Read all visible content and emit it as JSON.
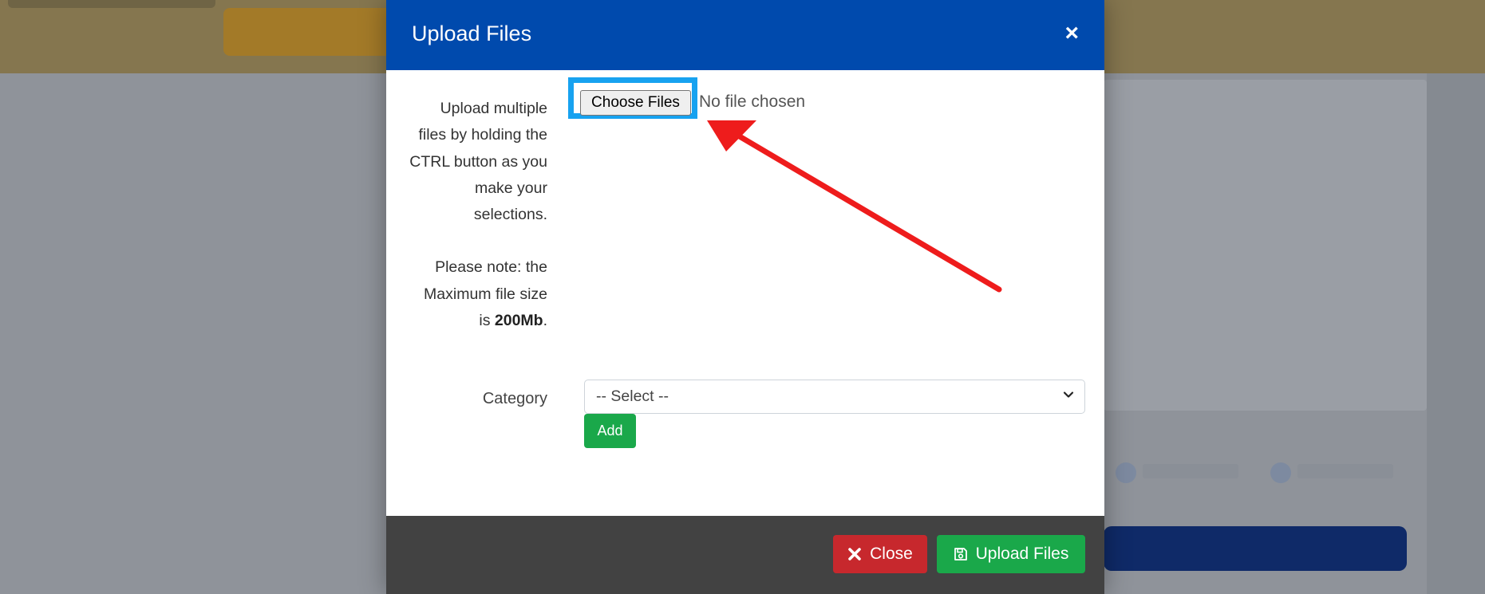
{
  "modal": {
    "title": "Upload Files",
    "close_symbol": "×"
  },
  "help": {
    "lines": [
      "Upload multiple",
      "files by holding the",
      "CTRL button as you",
      "make your",
      "selections."
    ],
    "note_lines": [
      "Please note: the",
      "Maximum file size"
    ],
    "size_prefix": "is ",
    "size_value": "200Mb",
    "size_suffix": "."
  },
  "file_input": {
    "button_label": "Choose Files",
    "status": "No file chosen"
  },
  "category": {
    "label": "Category",
    "selected": "-- Select --",
    "add_label": "Add"
  },
  "footer": {
    "close_label": "Close",
    "upload_label": "Upload Files"
  },
  "icons": {
    "close": "x-icon",
    "upload": "floppy-disk-icon",
    "select": "chevron-down-icon",
    "annotation": "red-arrow"
  },
  "colors": {
    "header": "#004aad",
    "highlight": "#17a2f0",
    "arrow": "#ee1c1c",
    "success": "#1aa84a",
    "danger": "#c7282d"
  }
}
